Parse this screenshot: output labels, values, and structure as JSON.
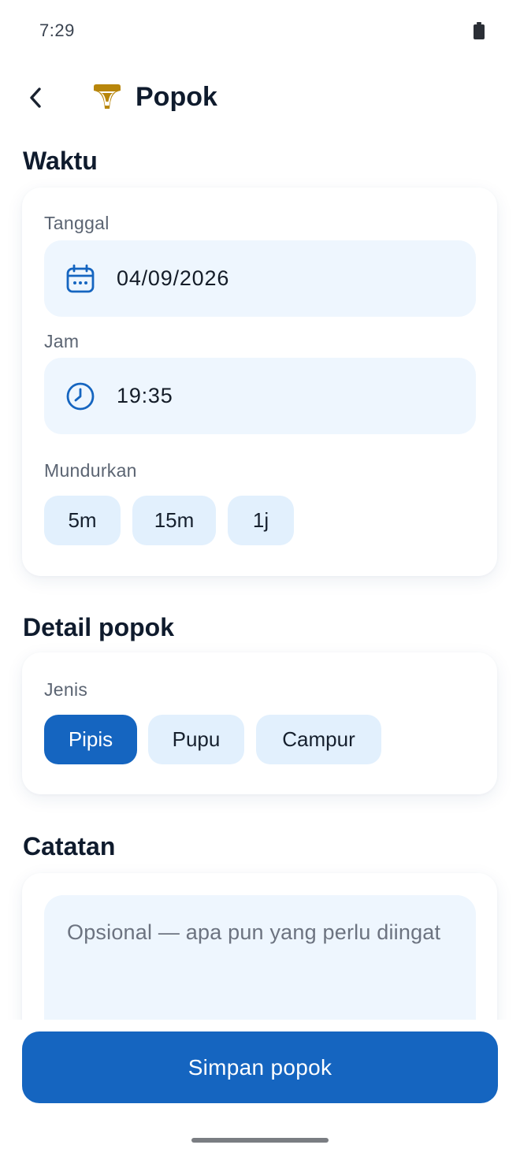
{
  "status_bar": {
    "time": "7:29"
  },
  "header": {
    "title": "Popok",
    "back_icon": "chevron-left-icon",
    "title_icon": "diaper-icon",
    "icon_color": "#b8860b"
  },
  "waktu": {
    "section_title": "Waktu",
    "date_label": "Tanggal",
    "date_value": "04/09/2026",
    "time_label": "Jam",
    "time_value": "19:35",
    "backdate_label": "Mundurkan",
    "backdate_options": [
      "5m",
      "15m",
      "1j"
    ]
  },
  "detail": {
    "section_title": "Detail popok",
    "type_label": "Jenis",
    "type_options": [
      "Pipis",
      "Pupu",
      "Campur"
    ],
    "selected_type": "Pipis"
  },
  "notes": {
    "section_title": "Catatan",
    "placeholder": "Opsional — apa pun yang perlu diingat"
  },
  "footer": {
    "save_label": "Simpan popok"
  },
  "colors": {
    "primary": "#1565c0",
    "chip_bg": "#e2f0fd",
    "field_bg": "#eef6fe",
    "accent_icon": "#b8860b"
  }
}
